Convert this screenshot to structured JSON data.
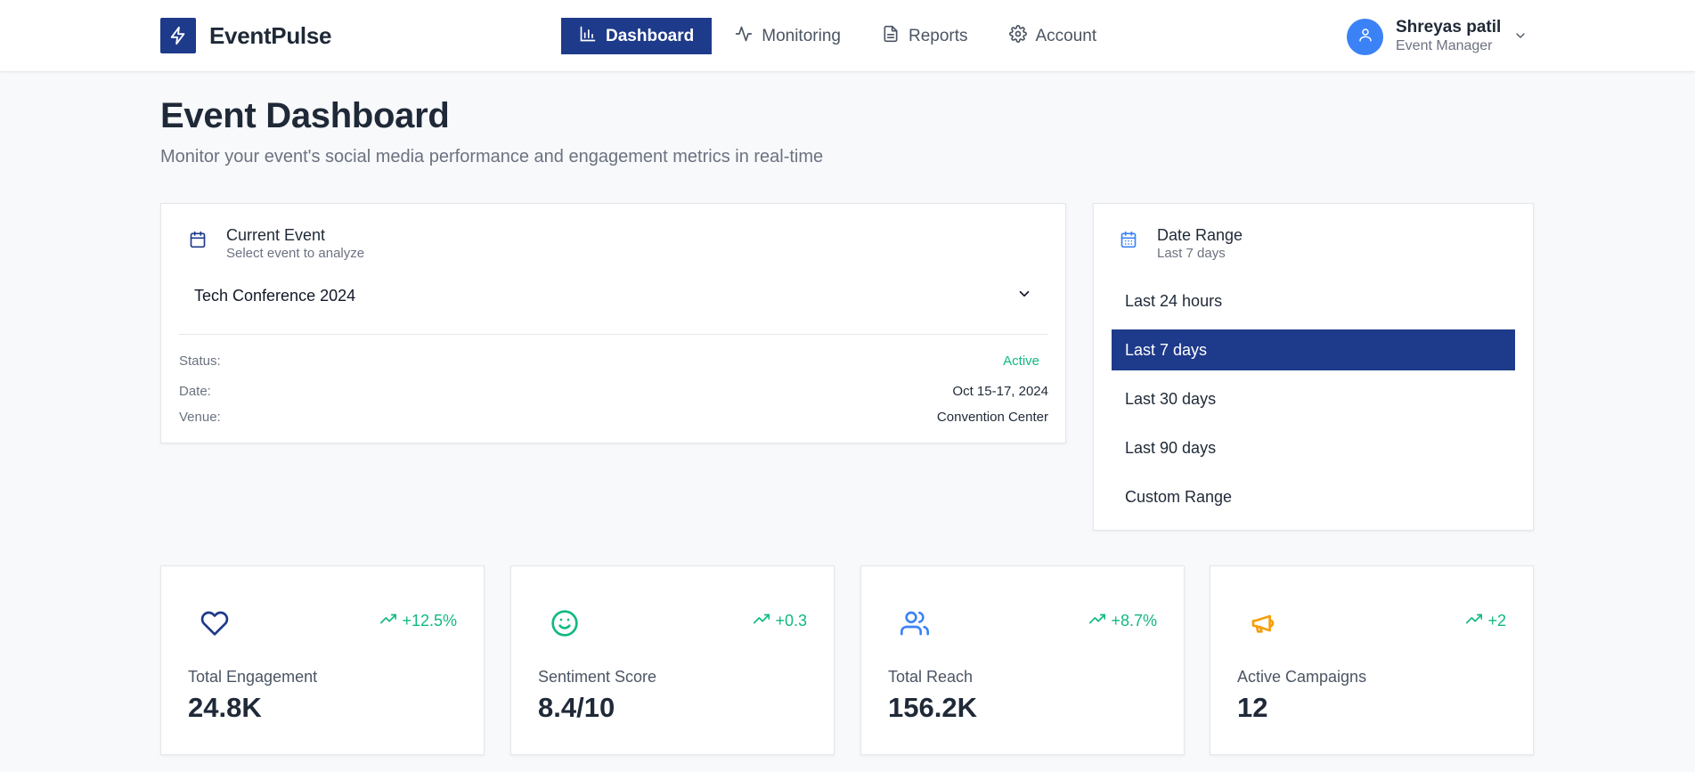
{
  "app": {
    "name": "EventPulse",
    "brand_color": "#1e3a8a"
  },
  "nav": {
    "items": [
      {
        "label": "Dashboard",
        "icon": "bar-chart-icon",
        "active": true
      },
      {
        "label": "Monitoring",
        "icon": "activity-icon",
        "active": false
      },
      {
        "label": "Reports",
        "icon": "file-text-icon",
        "active": false
      },
      {
        "label": "Account",
        "icon": "gear-icon",
        "active": false
      }
    ]
  },
  "user": {
    "name": "Shreyas patil",
    "role": "Event Manager",
    "icon": "user-icon"
  },
  "page": {
    "title": "Event Dashboard",
    "subtitle": "Monitor your event's social media performance and engagement metrics in real-time"
  },
  "event_card": {
    "title": "Current Event",
    "subtitle": "Select event to analyze",
    "selected_event": "Tech Conference 2024",
    "details": {
      "status_label": "Status:",
      "status_value": "Active",
      "date_label": "Date:",
      "date_value": "Oct 15-17, 2024",
      "venue_label": "Venue:",
      "venue_value": "Convention Center"
    }
  },
  "date_card": {
    "title": "Date Range",
    "subtitle": "Last 7 days",
    "options": [
      "Last 24 hours",
      "Last 7 days",
      "Last 30 days",
      "Last 90 days",
      "Custom Range"
    ],
    "selected_index": 1
  },
  "metrics": [
    {
      "label": "Total Engagement",
      "value": "24.8K",
      "change": "+12.5%",
      "icon": "heart-icon",
      "icon_color": "#1e3a8a"
    },
    {
      "label": "Sentiment Score",
      "value": "8.4/10",
      "change": "+0.3",
      "icon": "smile-icon",
      "icon_color": "#10b981"
    },
    {
      "label": "Total Reach",
      "value": "156.2K",
      "change": "+8.7%",
      "icon": "users-icon",
      "icon_color": "#3b82f6"
    },
    {
      "label": "Active Campaigns",
      "value": "12",
      "change": "+2",
      "icon": "megaphone-icon",
      "icon_color": "#f59e0b"
    }
  ],
  "colors": {
    "positive": "#10b981",
    "background": "#f8f9fb"
  }
}
